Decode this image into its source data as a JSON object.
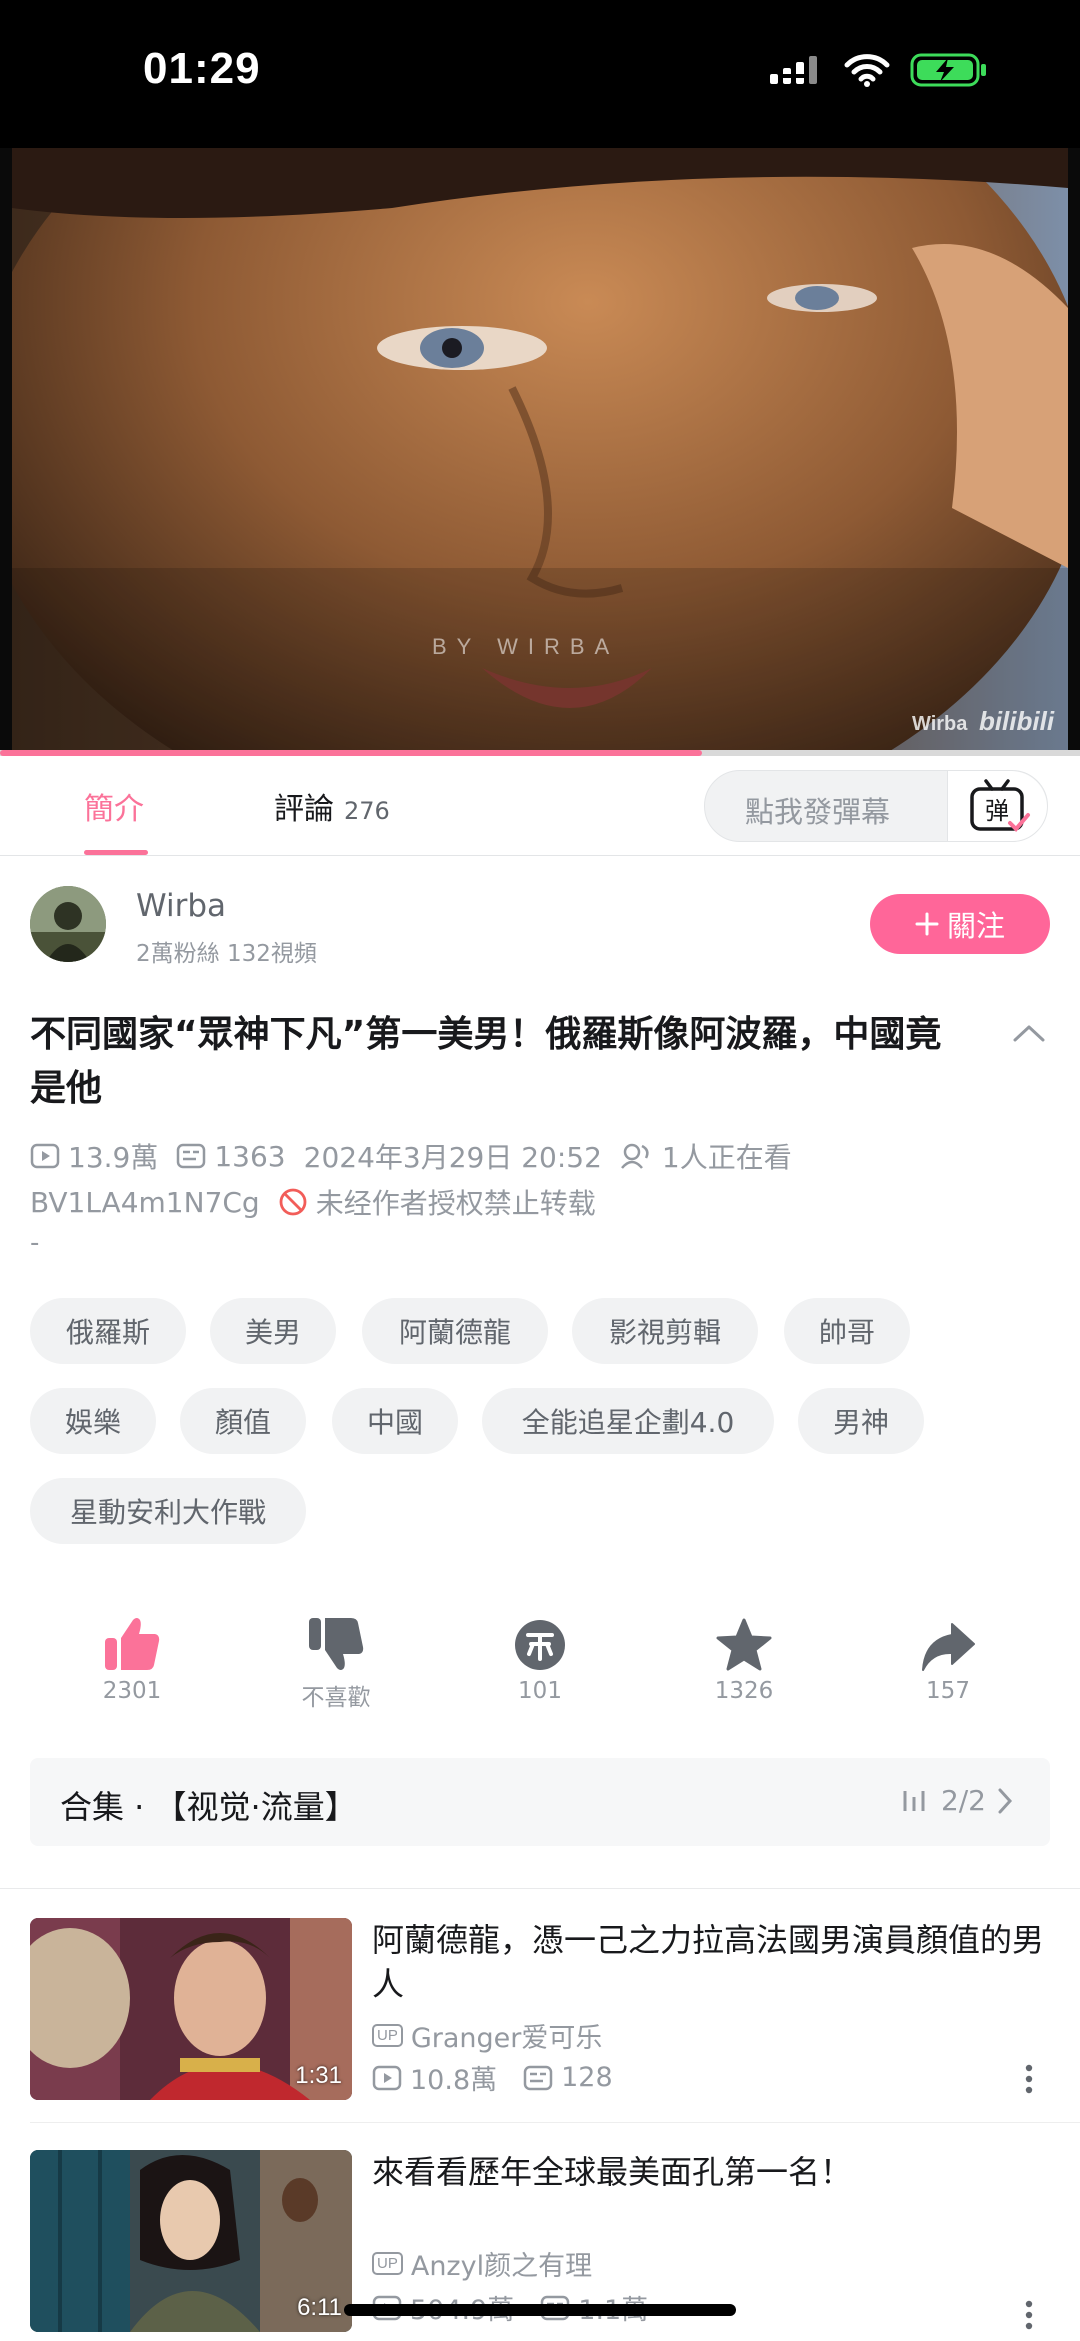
{
  "status_bar": {
    "time": "01:29"
  },
  "player": {
    "watermark_center": "BY  WIRBA",
    "watermark_author": "Wirba",
    "watermark_brand": "bilibili",
    "progress": 0.65
  },
  "tabs": {
    "intro_label": "簡介",
    "comments_label": "評論",
    "comments_count": "276",
    "danmaku_placeholder": "點我發彈幕",
    "danmaku_button_char": "弹"
  },
  "uploader": {
    "name": "Wirba",
    "stats": "2萬粉絲  132視頻",
    "follow_label": "關注"
  },
  "video": {
    "title": "不同國家“眾神下凡”第一美男！俄羅斯像阿波羅，中國竟是他",
    "views": "13.9萬",
    "danmaku_count": "1363",
    "date": "2024年3月29日 20:52",
    "watching": "1人正在看",
    "bvid": "BV1LA4m1N7Cg",
    "copyright": "未经作者授权禁止转载",
    "description": "-"
  },
  "tags": [
    "俄羅斯",
    "美男",
    "阿蘭德龍",
    "影視剪輯",
    "帥哥",
    "娛樂",
    "顏值",
    "中國",
    "全能追星企劃4.0",
    "男神",
    "星動安利大作戰"
  ],
  "actions": {
    "like": "2301",
    "dislike": "不喜歡",
    "coin": "101",
    "favorite": "1326",
    "share": "157"
  },
  "collection": {
    "label": "合集 · 【视觉·流量】",
    "progress": "2/2"
  },
  "recommendations": [
    {
      "title": "阿蘭德龍，憑一己之力拉高法國男演員顏值的男人",
      "uploader": "Granger爱可乐",
      "views": "10.8萬",
      "danmaku": "128",
      "duration": "1:31"
    },
    {
      "title": "來看看歷年全球最美面孔第一名！",
      "uploader": "Anzyl颜之有理",
      "views": "504.9萬",
      "danmaku": "1.1萬",
      "duration": "6:11"
    }
  ],
  "colors": {
    "accent": "#fb7299",
    "follow": "#ff6699",
    "text_primary": "#18191c",
    "text_secondary": "#9499a0"
  }
}
